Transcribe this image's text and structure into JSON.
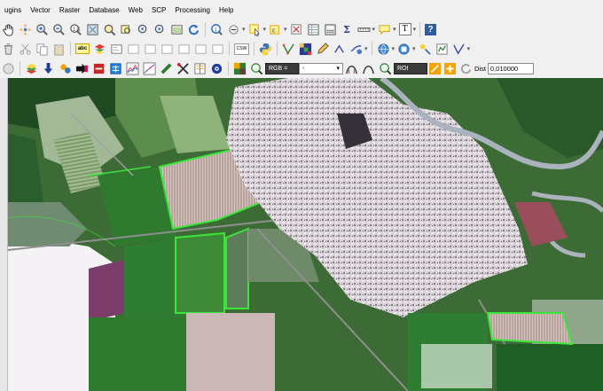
{
  "menu": [
    "ugins",
    "Vector",
    "Raster",
    "Database",
    "Web",
    "SCP",
    "Processing",
    "Help"
  ],
  "toolbar": {
    "rgb_label": "RGB =",
    "band_value": "-",
    "roi_label": "ROI",
    "dist_label": "Dist",
    "dist_value": "0,010000",
    "text_tool": "T",
    "sigma": "Σ",
    "help": "?",
    "csw": "CSW",
    "abc": "abc"
  },
  "colors": {
    "roi_outline": "#39e639",
    "urban": "#cfc7cf",
    "field_green": "#3f7f2e",
    "river": "#a9b2bd"
  }
}
